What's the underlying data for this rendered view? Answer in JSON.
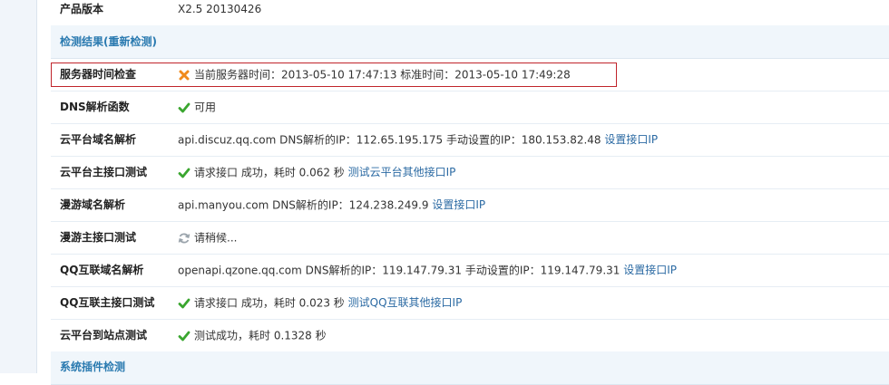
{
  "product": {
    "label": "产品版本",
    "value": "X2.5 20130426"
  },
  "section_results": {
    "title": "检测结果(重新检测)"
  },
  "rows": {
    "server_time": {
      "label": "服务器时间检查",
      "text": "当前服务器时间：2013-05-10 17:47:13 标准时间：2013-05-10 17:49:28"
    },
    "dns_func": {
      "label": "DNS解析函数",
      "text": "可用"
    },
    "cloud_domain": {
      "label": "云平台域名解析",
      "text": "api.discuz.qq.com DNS解析的IP：112.65.195.175 手动设置的IP：180.153.82.48",
      "link": "设置接口IP"
    },
    "cloud_api": {
      "label": "云平台主接口测试",
      "text": "请求接口 成功，耗时 0.062 秒",
      "link": "测试云平台其他接口IP"
    },
    "manyou_domain": {
      "label": "漫游域名解析",
      "text": "api.manyou.com DNS解析的IP：124.238.249.9",
      "link": "设置接口IP"
    },
    "manyou_api": {
      "label": "漫游主接口测试",
      "text": "请稍候..."
    },
    "qq_domain": {
      "label": "QQ互联域名解析",
      "text": "openapi.qzone.qq.com DNS解析的IP：119.147.79.31 手动设置的IP：119.147.79.31",
      "link": "设置接口IP"
    },
    "qq_api": {
      "label": "QQ互联主接口测试",
      "text": "请求接口 成功，耗时 0.023 秒",
      "link": "测试QQ互联其他接口IP"
    },
    "site_test": {
      "label": "云平台到站点测试",
      "text": "测试成功，耗时 0.1328 秒"
    }
  },
  "section_plugins": {
    "title": "系统插件检测"
  },
  "colors": {
    "header_text": "#2a7ab0",
    "link": "#2b6aa3",
    "ok_icon": "#3aa62f",
    "error_icon": "#f08a1c",
    "highlight_border": "#c0242b",
    "header_bg": "#f0f6fb"
  },
  "icons": {
    "ok": "check-icon",
    "error": "x-icon",
    "loading": "refresh-icon"
  }
}
